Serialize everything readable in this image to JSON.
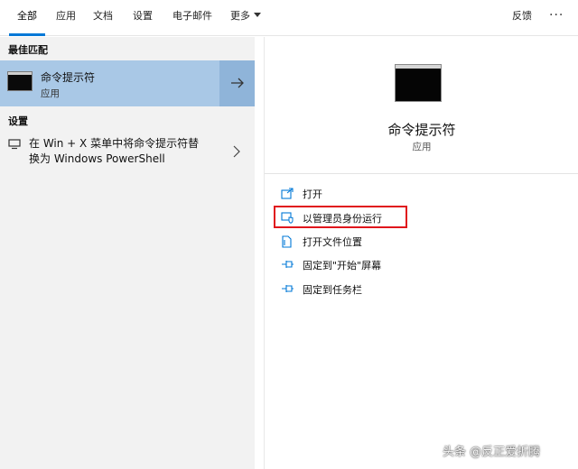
{
  "tabs": [
    {
      "label": "全部",
      "active": true
    },
    {
      "label": "应用"
    },
    {
      "label": "文档"
    },
    {
      "label": "设置"
    },
    {
      "label": "电子邮件"
    },
    {
      "label": "更多"
    }
  ],
  "topbar": {
    "feedback": "反馈",
    "more": "···"
  },
  "left": {
    "best_match_header": "最佳匹配",
    "best_match": {
      "title": "命令提示符",
      "subtitle": "应用"
    },
    "settings_header": "设置",
    "setting_item": {
      "line1": "在 Win + X 菜单中将命令提示符替",
      "line2": "换为 Windows PowerShell"
    }
  },
  "right": {
    "title": "命令提示符",
    "subtitle": "应用",
    "actions": [
      {
        "label": "打开",
        "icon": "open-icon"
      },
      {
        "label": "以管理员身份运行",
        "icon": "shield-icon",
        "highlighted": true
      },
      {
        "label": "打开文件位置",
        "icon": "file-location-icon"
      },
      {
        "label": "固定到\"开始\"屏幕",
        "icon": "pin-icon"
      },
      {
        "label": "固定到任务栏",
        "icon": "pin-icon"
      }
    ]
  },
  "watermark": "头条 @反正爱折腾",
  "colors": {
    "accent": "#0078d7",
    "selected_bg": "#a9c8e6",
    "highlight_border": "#e0161c"
  }
}
